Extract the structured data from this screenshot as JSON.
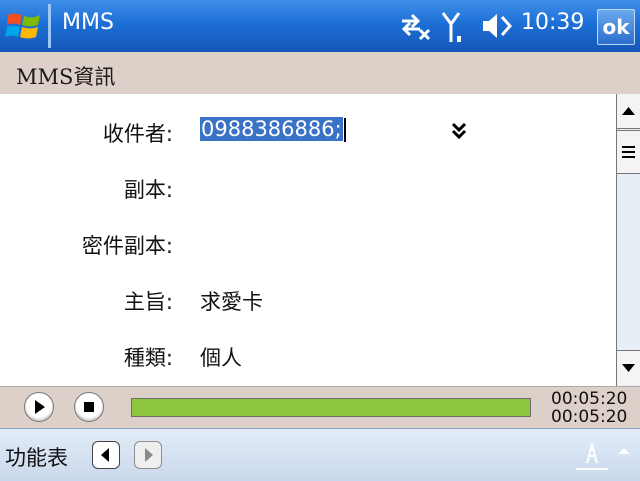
{
  "titlebar": {
    "app_title": "MMS",
    "clock": "10:39",
    "ok_label": "ok",
    "icons": [
      "windows-start-icon",
      "connectivity-icon",
      "signal-icon",
      "volume-muted-icon"
    ]
  },
  "header": {
    "title": "MMS資訊"
  },
  "form": {
    "to": {
      "label": "收件者:",
      "value": "0988386886;"
    },
    "cc": {
      "label": "副本:",
      "value": ""
    },
    "bcc": {
      "label": "密件副本:",
      "value": ""
    },
    "subject": {
      "label": "主旨:",
      "value": "求愛卡"
    },
    "type": {
      "label": "種類:",
      "value": "個人"
    }
  },
  "player": {
    "elapsed": "00:05:20",
    "total": "00:05:20",
    "progress": 1.0
  },
  "menubar": {
    "menu_label": "功能表"
  },
  "colors": {
    "titlebar": "#1d6fd6",
    "header_bg": "#ddd0c8",
    "selection": "#3a72c7",
    "progress": "#8dc63f"
  }
}
